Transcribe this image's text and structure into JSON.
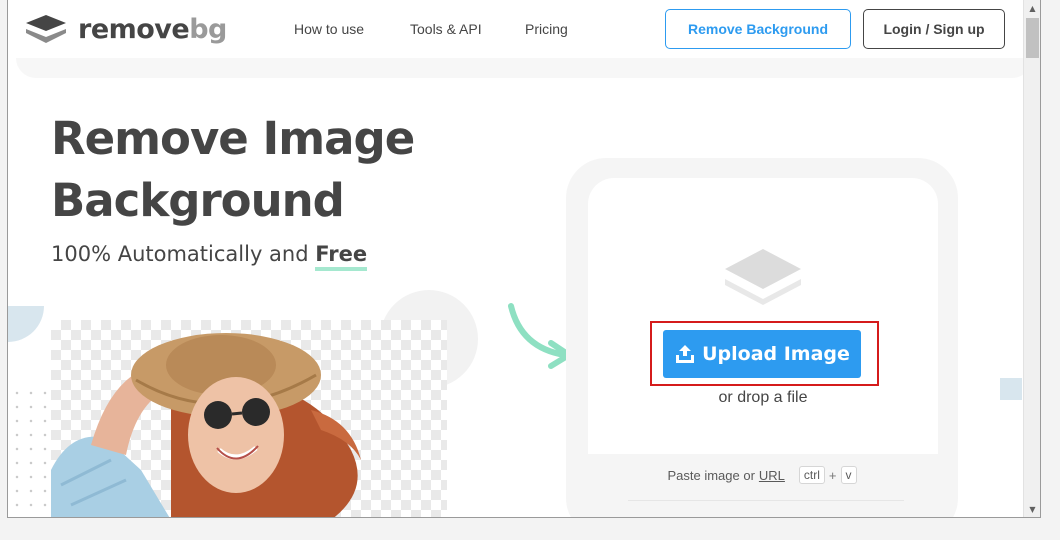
{
  "nav": {
    "logo_primary": "remove",
    "logo_secondary": "bg",
    "links": [
      "How to use",
      "Tools & API",
      "Pricing"
    ],
    "remove_button": "Remove Background",
    "login_button": "Login / Sign up"
  },
  "hero": {
    "title_line1": "Remove Image",
    "title_line2": "Background",
    "subtitle_prefix": "100% Automatically and",
    "subtitle_free": "Free"
  },
  "upload": {
    "button": "Upload Image",
    "drop_text": "or drop a file",
    "paste_prefix": "Paste image or",
    "paste_url": "URL",
    "kbd_ctrl": "ctrl",
    "kbd_plus": "+",
    "kbd_v": "v"
  },
  "colors": {
    "accent": "#2d9bf0",
    "text": "#454545",
    "highlight": "#d51b1b",
    "mint": "#a5e8cf"
  }
}
